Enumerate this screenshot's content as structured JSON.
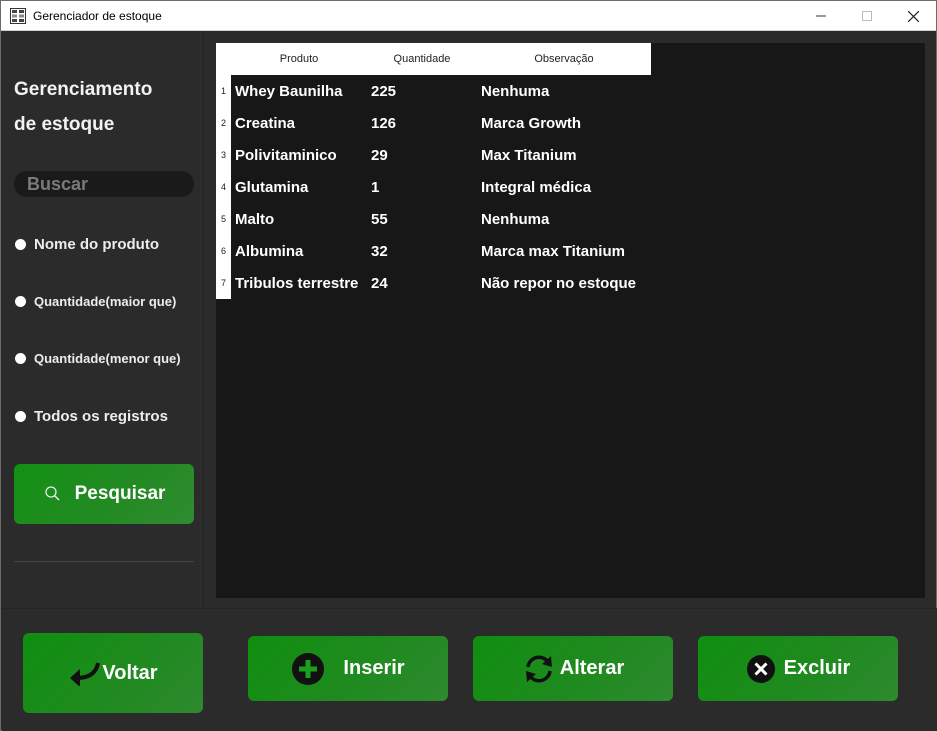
{
  "window": {
    "title": "Gerenciador de estoque",
    "icon": "grid-app-icon",
    "controls": [
      "minimize-icon",
      "maximize-icon",
      "close-icon"
    ]
  },
  "sidebar": {
    "title_line1": "Gerenciamento",
    "title_line2": "de estoque",
    "search_placeholder": "Buscar",
    "search_value": "",
    "filters": [
      {
        "label": "Nome do produto"
      },
      {
        "label": "Quantidade(maior que)"
      },
      {
        "label": "Quantidade(menor que)"
      },
      {
        "label": "Todos os registros"
      }
    ],
    "search_button": {
      "label": "Pesquisar",
      "icon": "magnifier-icon"
    }
  },
  "table": {
    "columns": [
      "Produto",
      "Quantidade",
      "Observação"
    ],
    "rows": [
      {
        "num": "1",
        "produto": "Whey Baunilha",
        "quantidade": "225",
        "observacao": "Nenhuma"
      },
      {
        "num": "2",
        "produto": "Creatina",
        "quantidade": "126",
        "observacao": "Marca Growth"
      },
      {
        "num": "3",
        "produto": "Polivitaminico",
        "quantidade": "29",
        "observacao": "Max Titanium"
      },
      {
        "num": "4",
        "produto": "Glutamina",
        "quantidade": "1",
        "observacao": "Integral médica"
      },
      {
        "num": "5",
        "produto": "Malto",
        "quantidade": "55",
        "observacao": "Nenhuma"
      },
      {
        "num": "6",
        "produto": "Albumina",
        "quantidade": "32",
        "observacao": "Marca max Titanium"
      },
      {
        "num": "7",
        "produto": "Tribulos terrestre",
        "quantidade": "24",
        "observacao": "Não repor no estoque"
      }
    ]
  },
  "actions": {
    "voltar": {
      "label": "Voltar",
      "icon": "back-arrow-icon"
    },
    "inserir": {
      "label": "Inserir",
      "icon": "plus-circle-icon"
    },
    "alterar": {
      "label": "Alterar",
      "icon": "refresh-icon"
    },
    "excluir": {
      "label": "Excluir",
      "icon": "x-circle-icon"
    }
  },
  "colors": {
    "background": "#2b2b2b",
    "table_background": "#171717",
    "button_green": "#1a8a1a",
    "text": "#ffffff"
  }
}
